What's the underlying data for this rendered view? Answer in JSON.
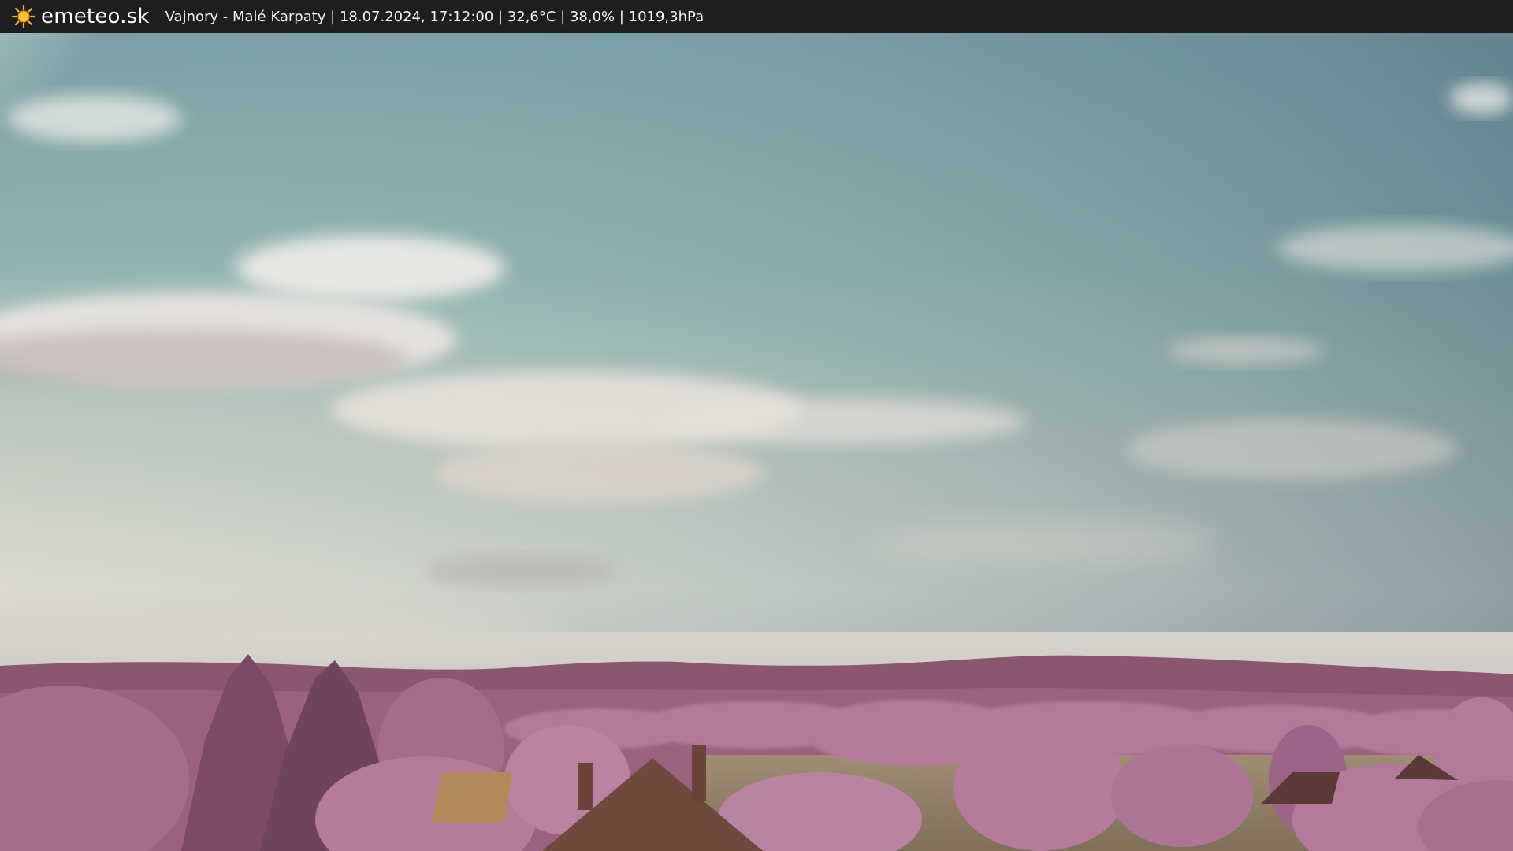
{
  "header": {
    "brand": "emeteo.sk",
    "brand_icon": "sun-icon",
    "caption": "Vajnory - Malé Karpaty | 18.07.2024, 17:12:00 | 32,6°C | 38,0% | 1019,3hPa"
  },
  "colors": {
    "bar_background": "#1e1e1e",
    "brand_sun": "#f5b21a",
    "sky_top": "#6f8f98",
    "sky_horizon": "#dcdad0",
    "hills": "#8a5670",
    "foliage": "#b07a9a",
    "field": "#8a7a62"
  }
}
